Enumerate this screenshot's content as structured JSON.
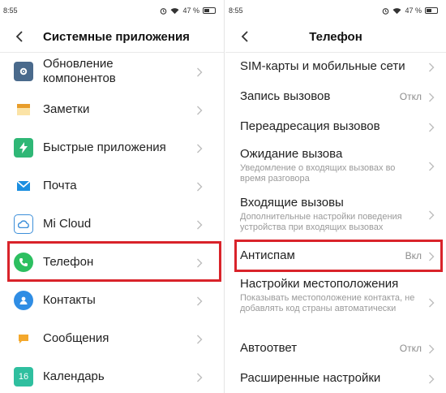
{
  "left": {
    "status": {
      "time": "8:55",
      "battery": "47 %"
    },
    "title": "Системные приложения",
    "items": [
      {
        "label": "Обновление компонентов",
        "icon": "gear-icon",
        "color": "#4a6a8c"
      },
      {
        "label": "Заметки",
        "icon": "notes-icon",
        "color": "#f5b94a"
      },
      {
        "label": "Быстрые приложения",
        "icon": "bolt-icon",
        "color": "#2fb776"
      },
      {
        "label": "Почта",
        "icon": "mail-icon",
        "color": "#1a8ee0"
      },
      {
        "label": "Mi Cloud",
        "icon": "cloud-icon",
        "color": "#3d8fd9"
      },
      {
        "label": "Телефон",
        "icon": "phone-icon",
        "color": "#2cbf60"
      },
      {
        "label": "Контакты",
        "icon": "contacts-icon",
        "color": "#2f8de4"
      },
      {
        "label": "Сообщения",
        "icon": "message-icon",
        "color": "#f4a82c"
      },
      {
        "label": "Календарь",
        "icon": "calendar-icon",
        "color": "#2fbf9f",
        "badge": "16"
      }
    ]
  },
  "right": {
    "status": {
      "time": "8:55",
      "battery": "47 %"
    },
    "title": "Телефон",
    "items": [
      {
        "title": "SIM-карты и мобильные сети",
        "subtitle": "",
        "value": ""
      },
      {
        "title": "Запись вызовов",
        "subtitle": "",
        "value": "Откл"
      },
      {
        "title": "Переадресация вызовов",
        "subtitle": "",
        "value": ""
      },
      {
        "title": "Ожидание вызова",
        "subtitle": "Уведомление о входящих вызовах во время разговора",
        "value": ""
      },
      {
        "title": "Входящие вызовы",
        "subtitle": "Дополнительные настройки поведения устройства при входящих вызовах",
        "value": ""
      },
      {
        "title": "Антиспам",
        "subtitle": "",
        "value": "Вкл"
      },
      {
        "title": "Настройки местоположения",
        "subtitle": "Показывать местоположение контакта, не добавлять код страны автоматически",
        "value": ""
      },
      {
        "title": "Автоответ",
        "subtitle": "",
        "value": "Откл"
      },
      {
        "title": "Расширенные настройки",
        "subtitle": "",
        "value": ""
      }
    ]
  },
  "highlight_color": "#d9232a"
}
